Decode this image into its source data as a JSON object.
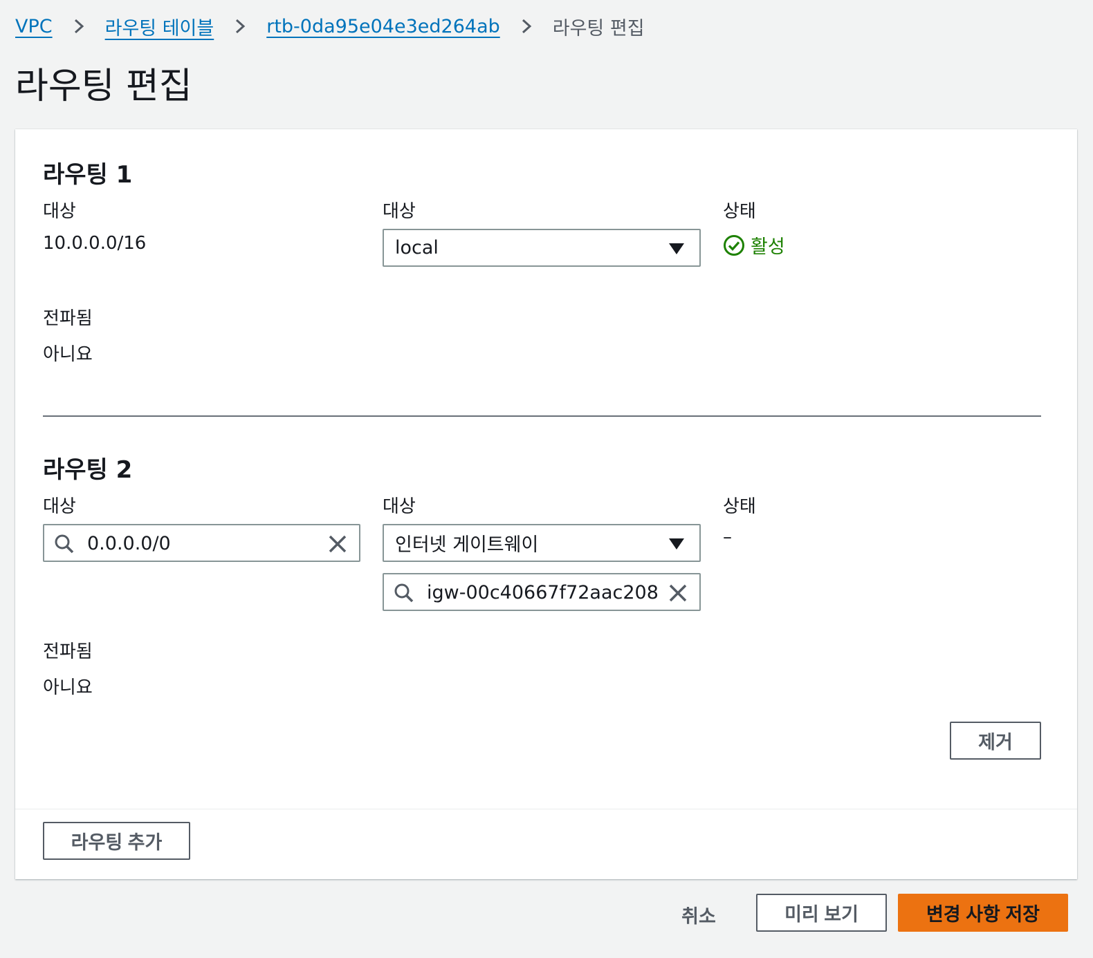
{
  "breadcrumb": {
    "items": [
      "VPC",
      "라우팅 테이블",
      "rtb-0da95e04e3ed264ab"
    ],
    "current": "라우팅 편집"
  },
  "page_title": "라우팅 편집",
  "routes": [
    {
      "title": "라우팅 1",
      "destination_label": "대상",
      "destination_value": "10.0.0.0/16",
      "target_label": "대상",
      "target_value": "local",
      "status_label": "상태",
      "status_value": "활성",
      "propagated_label": "전파됨",
      "propagated_value": "아니요"
    },
    {
      "title": "라우팅 2",
      "destination_label": "대상",
      "destination_value": "0.0.0.0/0",
      "target_label": "대상",
      "target_value": "인터넷 게이트웨이",
      "target_resource": "igw-00c40667f72aac208",
      "status_label": "상태",
      "status_value": "–",
      "propagated_label": "전파됨",
      "propagated_value": "아니요",
      "remove_label": "제거"
    }
  ],
  "add_route_label": "라우팅 추가",
  "actions": {
    "cancel": "취소",
    "preview": "미리 보기",
    "save": "변경 사항 저장"
  },
  "colors": {
    "link": "#0073bb",
    "success": "#1d8102",
    "primary": "#ec7211",
    "background": "#f2f3f3"
  }
}
